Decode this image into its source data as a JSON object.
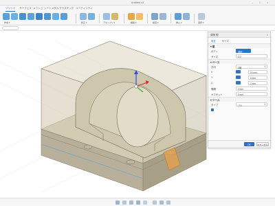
{
  "window": {
    "title": "Untitled v1",
    "controls": [
      "–",
      "□",
      "×"
    ]
  },
  "ribbon": {
    "tabs": [
      {
        "label": "ソリッド",
        "active": true
      },
      {
        "label": "サーフェス",
        "active": false
      },
      {
        "label": "メッシュ",
        "active": false
      },
      {
        "label": "シートメタル",
        "active": false
      },
      {
        "label": "プラスチック",
        "active": false
      },
      {
        "label": "ユーティリティ",
        "active": false
      }
    ],
    "groups": [
      {
        "label": "作成 ▾"
      },
      {
        "label": "修正 ▾"
      },
      {
        "label": "アセンブリ ▾"
      },
      {
        "label": "構築 ▾"
      },
      {
        "label": "検査 ▾"
      },
      {
        "label": "挿入 ▾"
      },
      {
        "label": "選択 ▾"
      }
    ]
  },
  "panel": {
    "title": "成形 型",
    "tabs": [
      "設定",
      "サイズ"
    ],
    "sections": [
      {
        "label": "▾ 型"
      },
      {
        "label": "▾ ベース"
      },
      {
        "label": "▾ ツール"
      }
    ],
    "rows": [
      {
        "label": "ボディ",
        "value": "選択"
      },
      {
        "label": "サイズ",
        "value": "0.0"
      },
      {
        "label": "方向",
        "value": "Z軸"
      },
      {
        "label": "X",
        "value": "10 mm"
      },
      {
        "label": "Y",
        "value": "5 mm"
      },
      {
        "label": "Z",
        "value": "2 mm"
      },
      {
        "label": "間隔",
        "value": "0 mm"
      },
      {
        "label": "オフセット",
        "value": "0 mm"
      },
      {
        "label": "タイプ",
        "value": "フル"
      }
    ],
    "ok_label": "OK",
    "cancel_label": "キャンセル"
  },
  "colors": {
    "accent": "#2f74c8",
    "model_top": "#ddd6c0",
    "model_side": "#cfc7ad",
    "base_top": "#d7d0b8",
    "base_side_left": "#b8b09a",
    "base_side_right": "#a89f87",
    "highlight": "#e8a048"
  }
}
